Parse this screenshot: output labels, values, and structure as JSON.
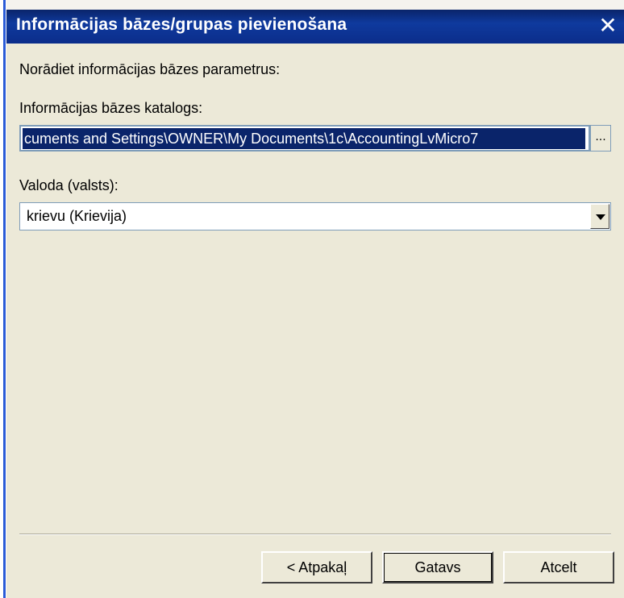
{
  "window": {
    "title": "Informācijas bāzes/grupas pievienošana",
    "close_glyph": "✕"
  },
  "form": {
    "intro_label": "Norādiet informācijas bāzes parametrus:",
    "directory_label": "Informācijas bāzes katalogs:",
    "directory_value": "cuments and Settings\\OWNER\\My Documents\\1c\\AccountingLvMicro7",
    "browse_label": "...",
    "language_label": "Valoda (valsts):",
    "language_value": "krievu (Krievija)"
  },
  "buttons": {
    "back": "< Atpakaļ",
    "finish": "Gatavs",
    "cancel": "Atcelt"
  },
  "colors": {
    "titlebar": "#0a246a",
    "selection": "#0a246a",
    "dialog_bg": "#ece9d8"
  }
}
